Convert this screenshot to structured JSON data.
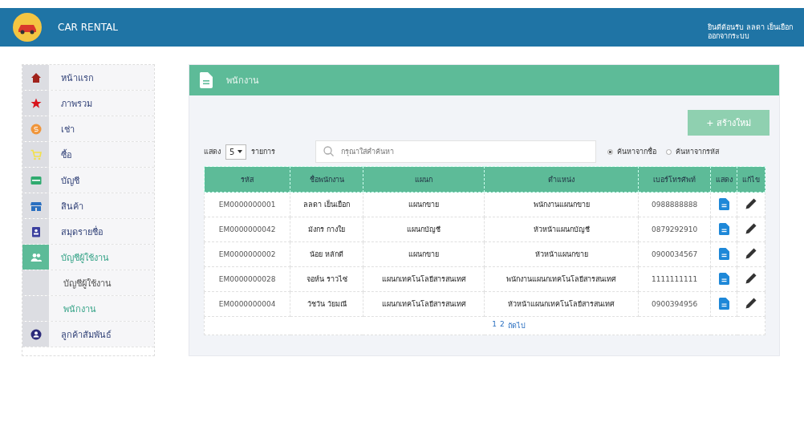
{
  "header": {
    "title": "CAR RENTAL",
    "welcome": "ยินดีต้อนรับ ลลดา เย็นเยือก",
    "logout": "ออกจากระบบ"
  },
  "sidebar": {
    "items": [
      {
        "label": "หน้าแรก",
        "selected": false
      },
      {
        "label": "ภาพรวม",
        "selected": false
      },
      {
        "label": "เช่า",
        "selected": false
      },
      {
        "label": "ซื้อ",
        "selected": false
      },
      {
        "label": "บัญชี",
        "selected": false
      },
      {
        "label": "สินค้า",
        "selected": false
      },
      {
        "label": "สมุดรายชื่อ",
        "selected": false
      },
      {
        "label": "บัญชีผู้ใช้งาน",
        "selected": true,
        "children": [
          {
            "label": "บัญชีผู้ใช้งาน",
            "selected": false
          },
          {
            "label": "พนักงาน",
            "selected": true
          }
        ]
      },
      {
        "label": "ลูกค้าสัมพันธ์",
        "selected": false
      }
    ]
  },
  "panel": {
    "title": "พนักงาน",
    "create_button": "+ สร้างใหม่",
    "show_label": "แสดง",
    "page_size": "5",
    "items_label": "รายการ",
    "search": {
      "placeholder": "กรุณาใส่คำค้นหา"
    },
    "search_modes": [
      {
        "label": "ค้นหาจากชื่อ",
        "selected": true
      },
      {
        "label": "ค้นหาจากรหัส",
        "selected": false
      }
    ],
    "table": {
      "columns": [
        "รหัส",
        "ชื่อพนักงาน",
        "แผนก",
        "ตำแหน่ง",
        "เบอร์โทรศัพท์",
        "แสดง",
        "แก้ไข"
      ],
      "rows": [
        {
          "id": "EM0000000001",
          "name": "ลลดา เย็นเยือก",
          "department": "แผนกขาย",
          "position": "พนักงานแผนกขาย",
          "phone": "0988888888"
        },
        {
          "id": "EM0000000042",
          "name": "มังกร กางใย",
          "department": "แผนกบัญชี",
          "position": "หัวหน้าแผนกบัญชี",
          "phone": "0879292910"
        },
        {
          "id": "EM0000000002",
          "name": "น้อย หลักดี",
          "department": "แผนกขาย",
          "position": "หัวหน้าแผนกขาย",
          "phone": "0900034567"
        },
        {
          "id": "EM0000000028",
          "name": "จอห์น ราวไซ่",
          "department": "แผนกเทคโนโลยีสารสนเทศ",
          "position": "พนักงานแผนกเทคโนโลยีสารสนเทศ",
          "phone": "1111111111"
        },
        {
          "id": "EM0000000004",
          "name": "วัชวัน วัยมณี",
          "department": "แผนกเทคโนโลยีสารสนเทศ",
          "position": "หัวหน้าแผนกเทคโนโลยีสารสนเทศ",
          "phone": "0900394956"
        }
      ]
    },
    "pagination": [
      "1",
      "2",
      "ถัดไป"
    ]
  }
}
